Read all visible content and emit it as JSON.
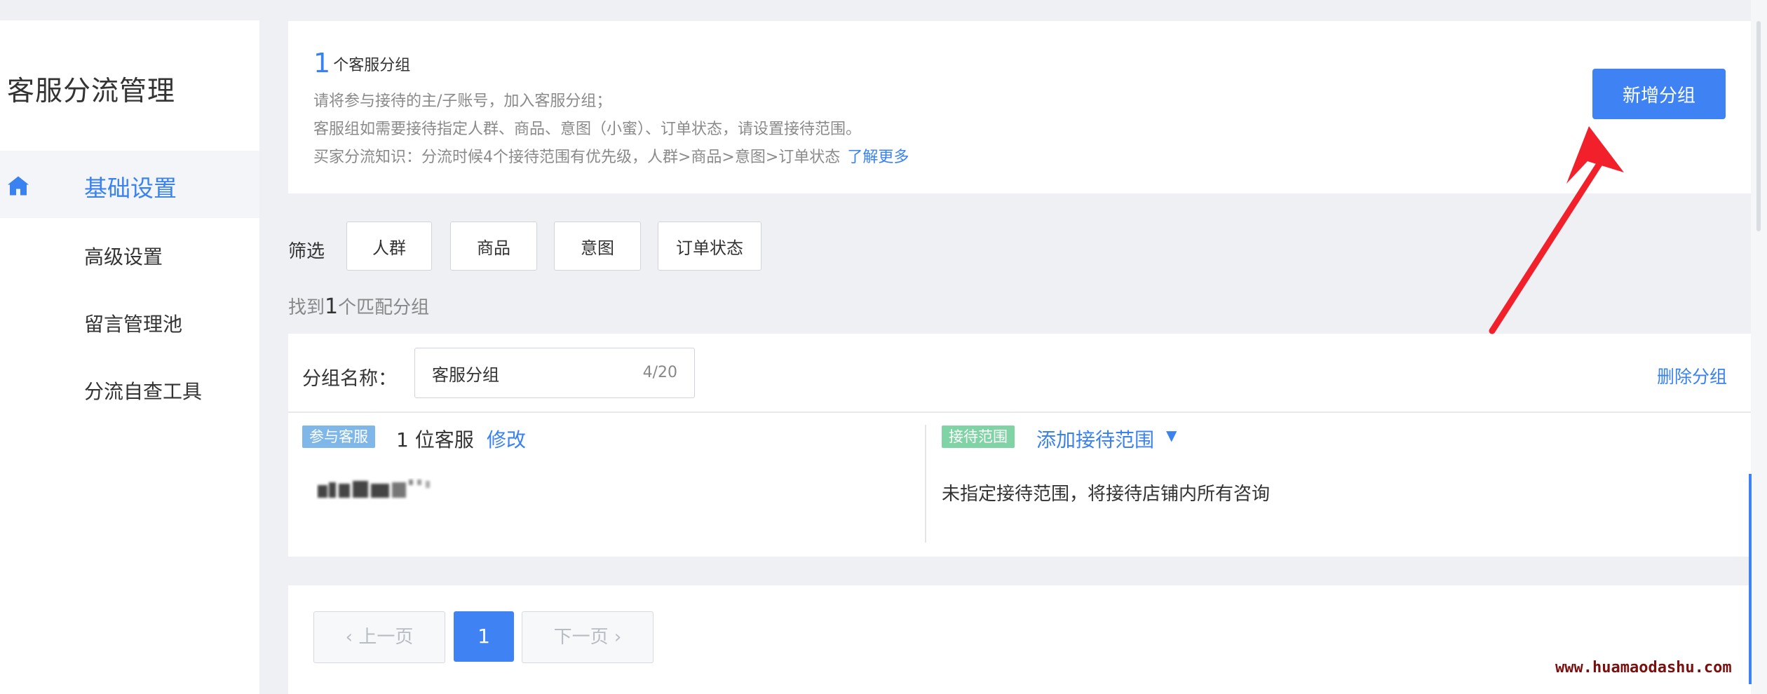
{
  "sidebar": {
    "title": "客服分流管理",
    "items": [
      {
        "label": "基础设置",
        "active": true,
        "icon": "home-icon"
      },
      {
        "label": "高级设置"
      },
      {
        "label": "留言管理池"
      },
      {
        "label": "分流自查工具"
      }
    ]
  },
  "info": {
    "count": "1",
    "count_label": "个客服分组",
    "line1": "请将参与接待的主/子账号，加入客服分组；",
    "line2": "客服组如需要接待指定人群、商品、意图（小蜜）、订单状态，请设置接待范围。",
    "line3": "买家分流知识：分流时候4个接待范围有优先级，人群>商品>意图>订单状态",
    "learn_more": "了解更多",
    "add_group": "新增分组"
  },
  "filter": {
    "label": "筛选",
    "options": [
      "人群",
      "商品",
      "意图",
      "订单状态"
    ]
  },
  "found": {
    "prefix": "找到",
    "count": "1",
    "suffix": "个匹配分组"
  },
  "group": {
    "name_label": "分组名称：",
    "name_value": "客服分组",
    "name_count": "4/20",
    "delete": "删除分组",
    "staff_tag": "参与客服",
    "staff_count": "1 位客服",
    "edit": "修改",
    "range_tag": "接待范围",
    "add_range": "添加接待范围",
    "caret": "▼",
    "range_desc": "未指定接待范围，将接待店铺内所有咨询"
  },
  "pager": {
    "prev": "‹ 上一页",
    "current": "1",
    "next": "下一页 ›"
  },
  "watermark": "www.huamaodashu.com",
  "colors": {
    "accent": "#3f82f3",
    "staff_tag": "#7fb8e8",
    "range_tag": "#7fd3a5",
    "arrow": "#f2202a"
  }
}
